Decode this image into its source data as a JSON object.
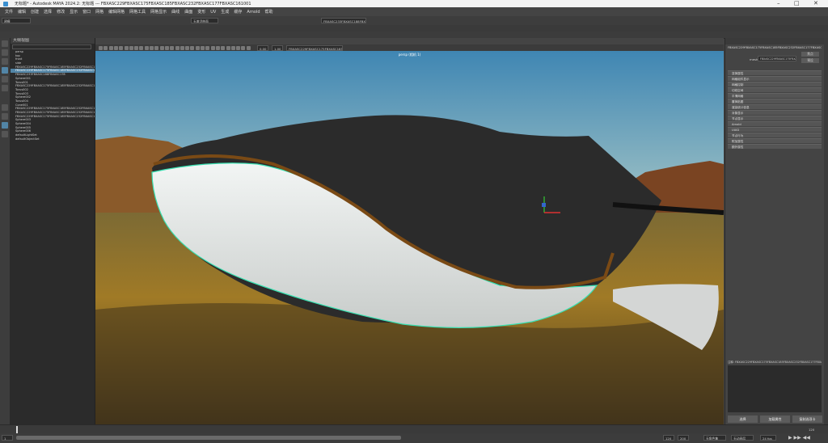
{
  "window": {
    "title": "无标题* - Autodesk MAYA 2024.2: 无标题   ---   FBXASC229FBXASC175FBXASC185FBXASC232FBXASC177FBXASC161001"
  },
  "menubar": {
    "items": [
      "文件",
      "编辑",
      "创建",
      "选择",
      "修改",
      "显示",
      "窗口",
      "网格",
      "编辑网格",
      "网格工具",
      "网格显示",
      "曲线",
      "曲面",
      "变形",
      "UV",
      "生成",
      "缓存",
      "Arnold",
      "帮助"
    ]
  },
  "statusline": {
    "mode": "建模",
    "object_field": "FBXASC233FBXASC188FBXASC178",
    "no_live_surface": "无激活曲面"
  },
  "outliner": {
    "title": "大纲视图",
    "items": [
      "persp",
      "top",
      "front",
      "side",
      "FBXASC229FBXASC175FBXASC185FBXASC232FBXASC177FBXASC161",
      "FBXASC229FBXASC175FBXASC185FBXASC232FBXASC177FBXASC161001",
      "FBXASC233FBXASC188FBXASC178",
      "Sphere001",
      "Torus001",
      "FBXASC229FBXASC175FBXASC185FBXASC232FBXASC177FBXASC161002",
      "Torus002",
      "Torus003",
      "Sphere002",
      "Torus004",
      "Cone001",
      "FBXASC229FBXASC175FBXASC185FBXASC232FBXASC177FBXASC161003",
      "FBXASC229FBXASC175FBXASC185FBXASC232FBXASC177FBXASC161004",
      "FBXASC229FBXASC175FBXASC185FBXASC232FBXASC177FBXASC161005",
      "Sphere003",
      "Sphere004",
      "Sphere005",
      "Sphere006",
      "defaultLightSet",
      "defaultObjectSet"
    ],
    "selected_index": 5
  },
  "viewport": {
    "camera_label": "persp (相机 1)",
    "camera_field": "FBXASC229FBXASC175FBXASC185 - ACES 1.0 SDR-video (sRGB)",
    "exposure": "0.00",
    "gamma": "1.00"
  },
  "attribute_editor": {
    "tabs": [
      "列表",
      "选定",
      "焦点",
      "属性",
      "显示",
      "显示",
      "帮助"
    ],
    "node_tab": "FBXASC229FBXASC175FBXASC185FBXASC232FBXASC177FBXASC161001Shape",
    "mesh_label": "mesh:",
    "mesh_value": "FBXASC229FBXASC175FBXASC185FBXASC232Shape",
    "focus_button": "焦点",
    "presets_button": "预设",
    "show_button": "显示",
    "hide_button": "隐藏",
    "sections": [
      "变换属性",
      "网格组件显示",
      "网格控制",
      "切线空间",
      "平滑网格",
      "置换贴图",
      "渲染统计信息",
      "对象显示",
      "节点显示",
      "Arnold",
      "UUID",
      "节点行为",
      "附加属性",
      "额外属性"
    ],
    "notes": "注释: FBXASC229FBXASC175FBXASC185FBXASC232FBXASC177FBXASC161001Shape",
    "btn_select": "选择",
    "btn_load_attrs": "加载属性",
    "btn_copy_tab": "复制选项卡"
  },
  "timeline": {
    "start": "1",
    "end": "120",
    "current": "1",
    "range_start": "1",
    "range_end": "120",
    "playback_end": "200",
    "character_set": "无角色集",
    "anim_layer": "无动画层",
    "fps": "24 fps"
  },
  "colors": {
    "sky_top": "#3f86b3",
    "sky_bottom": "#a4c5c6",
    "ground": "#8a6a1f",
    "whale_dark": "#2a2a2a",
    "whale_belly": "#dfe3e2",
    "wire": "#38e0b0",
    "trim": "#7a4a15",
    "selection": "#5285a6"
  },
  "icons": [
    "select-tool-icon",
    "lasso-tool-icon",
    "paint-select-icon",
    "move-tool-icon",
    "rotate-tool-icon",
    "scale-tool-icon",
    "layout-single-icon",
    "layout-four-icon",
    "outliner-icon",
    "window-minimize-icon",
    "window-maximize-icon",
    "window-close-icon",
    "play-icon",
    "maya-logo-icon"
  ]
}
